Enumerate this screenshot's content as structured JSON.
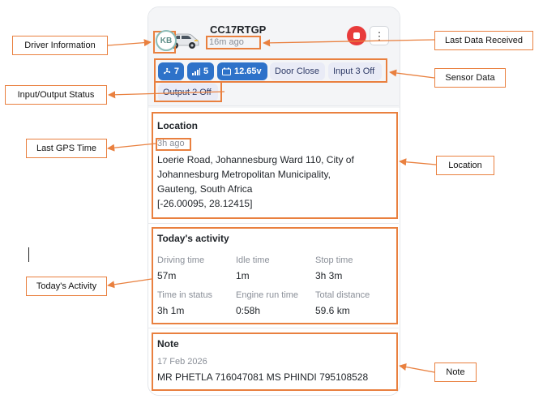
{
  "vehicle": {
    "avatar_initials": "KB",
    "id": "CC17RTGP",
    "last_data_received": "16m ago",
    "stop_icon": "stop-icon",
    "menu_icon": "more-vertical-icon"
  },
  "sensors": {
    "chips": [
      {
        "icon": "fan-icon",
        "value": "7"
      },
      {
        "icon": "signal-icon",
        "value": "5"
      },
      {
        "icon": "battery-icon",
        "value": "12.65v"
      }
    ],
    "door": "Door Close",
    "input3": "Input 3 Off",
    "output2": "Output 2 Off"
  },
  "location": {
    "title": "Location",
    "gps_time": "3h ago",
    "address_line1": "Loerie Road, Johannesburg Ward 110, City of",
    "address_line2": "Johannesburg Metropolitan Municipality,",
    "address_line3": "Gauteng, South Africa",
    "coords": "[-26.00095, 28.12415]"
  },
  "activity": {
    "title": "Today's activity",
    "stats": [
      {
        "label": "Driving time",
        "value": "57m"
      },
      {
        "label": "Idle time",
        "value": "1m"
      },
      {
        "label": "Stop time",
        "value": "3h 3m"
      },
      {
        "label": "Time in status",
        "value": "3h 1m"
      },
      {
        "label": "Engine run time",
        "value": "0:58h"
      },
      {
        "label": "Total distance",
        "value": "59.6 km"
      }
    ]
  },
  "note": {
    "title": "Note",
    "date": "17 Feb 2026",
    "text": "MR PHETLA 716047081 MS PHINDI 795108528"
  },
  "annotations": {
    "driver_information": "Driver Information",
    "last_data_received": "Last Data Received",
    "sensor_data": "Sensor Data",
    "input_output_status": "Input/Output Status",
    "last_gps_time": "Last GPS Time",
    "location": "Location",
    "todays_activity": "Today's Activity",
    "note": "Note"
  },
  "colors": {
    "accent_orange": "#e9803f",
    "chip_blue": "#2e72c9",
    "stop_red": "#e83b3b"
  }
}
